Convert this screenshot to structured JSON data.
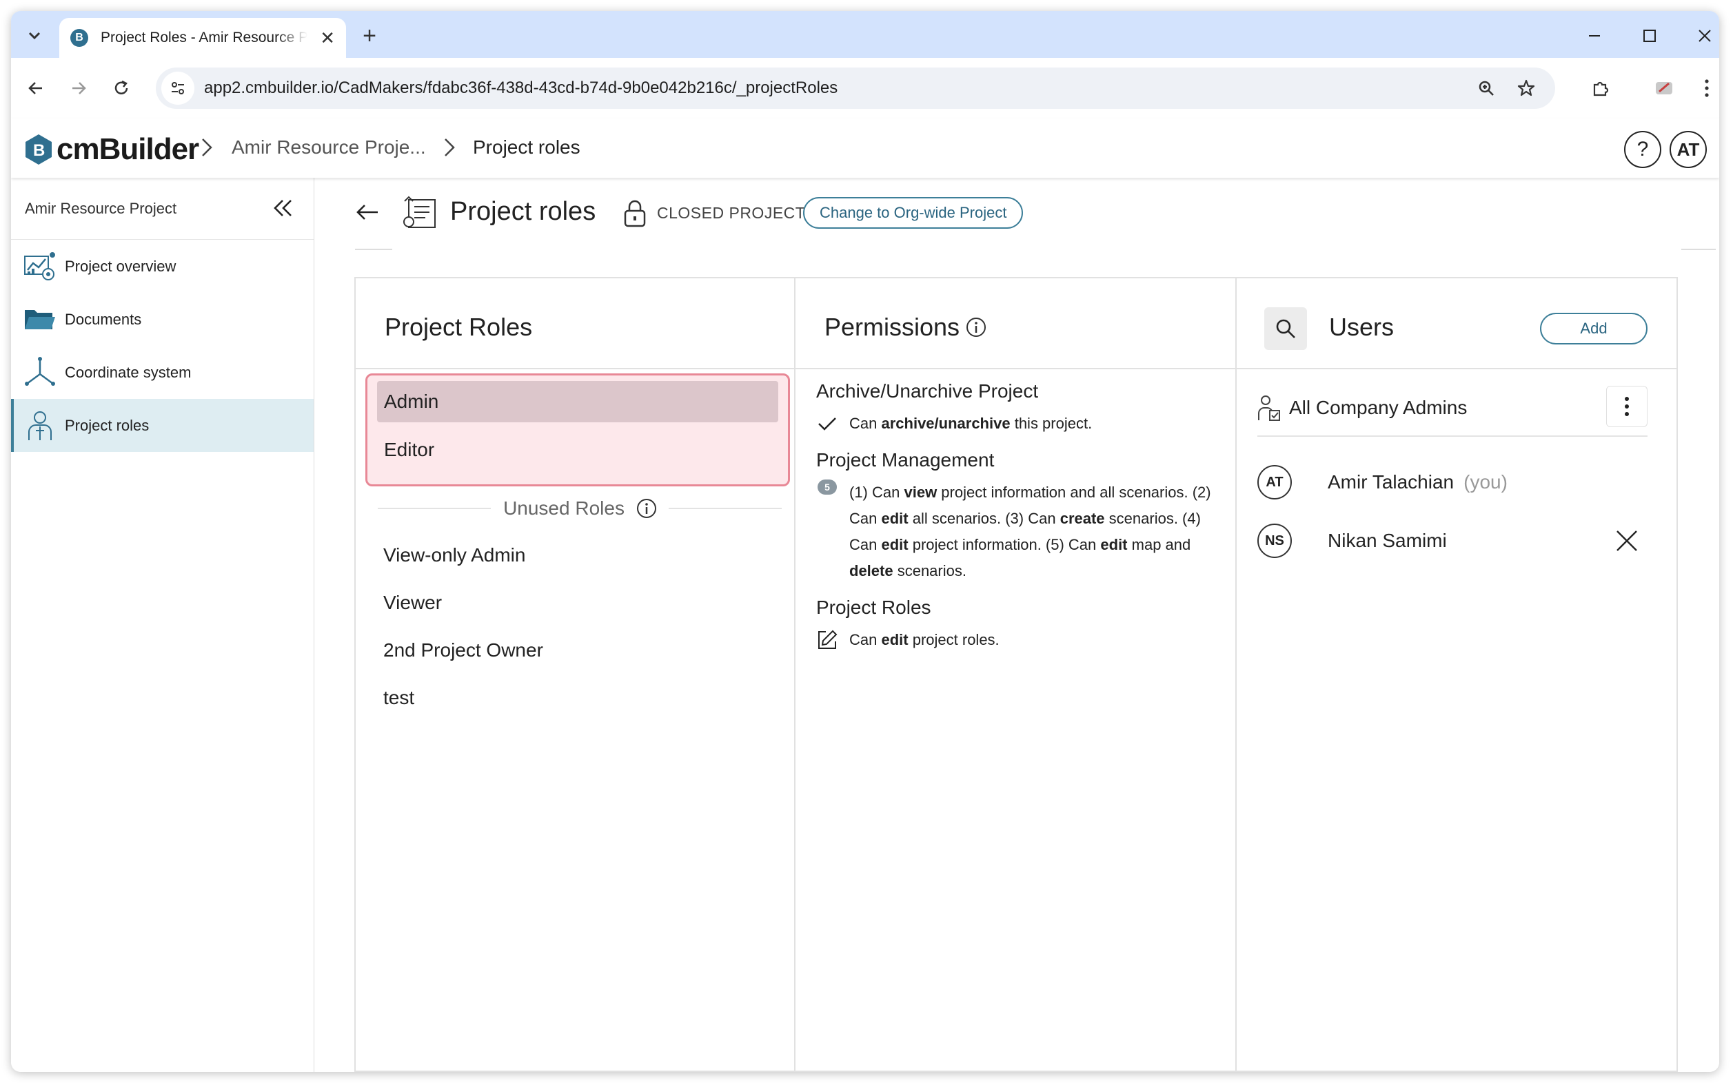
{
  "browser": {
    "tab_title": "Project Roles - Amir Resource Project",
    "favicon_letter": "B",
    "url": "app2.cmbuilder.io/CadMakers/fdabc36f-438d-43cd-b74d-9b0e042b216c/_projectRoles"
  },
  "app": {
    "logo_text": "cmBuilder",
    "breadcrumb": [
      "Amir Resource Proje...",
      "Project roles"
    ],
    "help_label": "?",
    "user_initials": "AT",
    "accent_color": "#3d7f99"
  },
  "sidebar": {
    "project_name": "Amir Resource Project",
    "items": [
      {
        "label": "Project overview",
        "icon": "project-overview-icon"
      },
      {
        "label": "Documents",
        "icon": "folder-icon"
      },
      {
        "label": "Coordinate system",
        "icon": "axes-icon"
      },
      {
        "label": "Project roles",
        "icon": "user-role-icon",
        "active": true
      }
    ]
  },
  "page": {
    "title": "Project roles",
    "status": "CLOSED PROJECT",
    "org_button": "Change to Org-wide Project"
  },
  "roles_panel": {
    "title": "Project Roles",
    "used_roles": [
      "Admin",
      "Editor"
    ],
    "selected_role": "Admin",
    "unused_label": "Unused Roles",
    "unused_roles": [
      "View-only Admin",
      "Viewer",
      "2nd Project Owner",
      "test"
    ]
  },
  "permissions_panel": {
    "title": "Permissions",
    "sections": [
      {
        "title": "Archive/Unarchive Project",
        "icon": "check-icon",
        "parts": [
          [
            "Can ",
            false
          ],
          [
            "archive/unarchive",
            true
          ],
          [
            " this project.",
            false
          ]
        ]
      },
      {
        "title": "Project Management",
        "icon": "count-badge",
        "badge": "5",
        "parts": [
          [
            "(1) Can ",
            false
          ],
          [
            "view",
            true
          ],
          [
            " project information and all scenarios. (2) Can ",
            false
          ],
          [
            "edit",
            true
          ],
          [
            " all scenarios. (3) Can ",
            false
          ],
          [
            "create",
            true
          ],
          [
            " scenarios. (4) Can ",
            false
          ],
          [
            "edit",
            true
          ],
          [
            " project information. (5) Can ",
            false
          ],
          [
            "edit",
            true
          ],
          [
            " map and ",
            false
          ],
          [
            "delete",
            true
          ],
          [
            " scenarios.",
            false
          ]
        ]
      },
      {
        "title": "Project Roles",
        "icon": "edit-icon",
        "parts": [
          [
            "Can ",
            false
          ],
          [
            "edit",
            true
          ],
          [
            " project roles.",
            false
          ]
        ]
      }
    ]
  },
  "users_panel": {
    "title": "Users",
    "add_label": "Add",
    "group": "All Company Admins",
    "users": [
      {
        "initials": "AT",
        "name": "Amir Talachian",
        "suffix": "(you)",
        "removable": false
      },
      {
        "initials": "NS",
        "name": "Nikan Samimi",
        "suffix": "",
        "removable": true
      }
    ]
  }
}
